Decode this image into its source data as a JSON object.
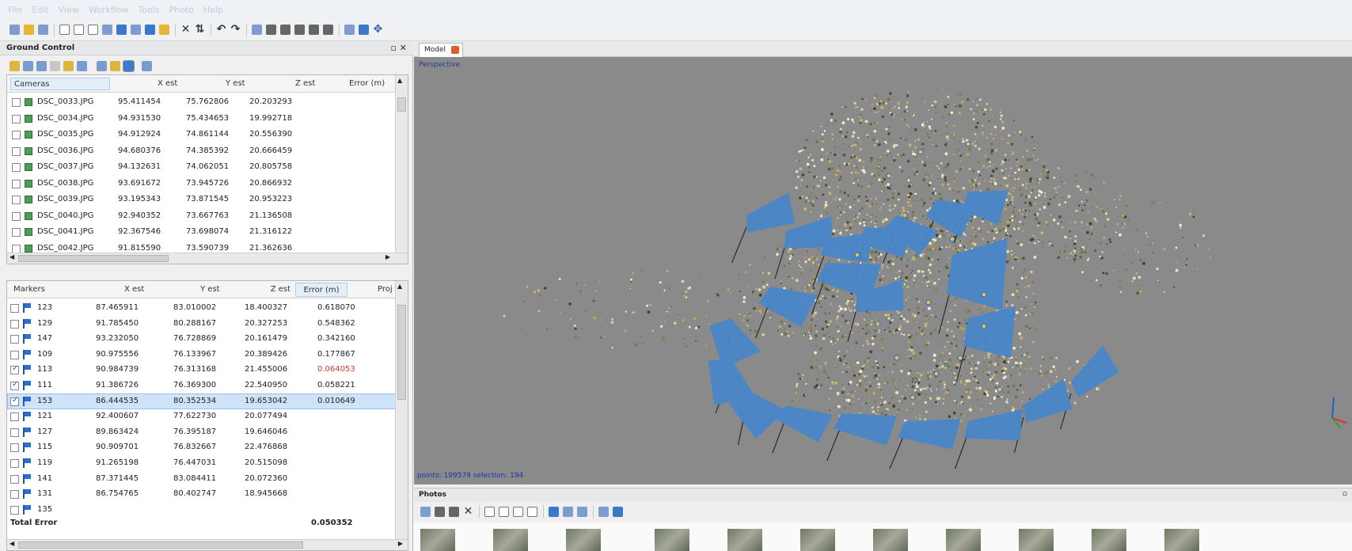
{
  "menu": [
    "File",
    "Edit",
    "View",
    "Workflow",
    "Tools",
    "Photo",
    "Help"
  ],
  "ground_control": {
    "title": "Ground Control",
    "cameras": {
      "headers": [
        "Cameras",
        "X est",
        "Y est",
        "Z est",
        "Error (m)"
      ],
      "rows": [
        {
          "name": "DSC_0033.JPG",
          "x": "95.411454",
          "y": "75.762806",
          "z": "20.203293"
        },
        {
          "name": "DSC_0034.JPG",
          "x": "94.931530",
          "y": "75.434653",
          "z": "19.992718"
        },
        {
          "name": "DSC_0035.JPG",
          "x": "94.912924",
          "y": "74.861144",
          "z": "20.556390"
        },
        {
          "name": "DSC_0036.JPG",
          "x": "94.680376",
          "y": "74.385392",
          "z": "20.666459"
        },
        {
          "name": "DSC_0037.JPG",
          "x": "94.132631",
          "y": "74.062051",
          "z": "20.805758"
        },
        {
          "name": "DSC_0038.JPG",
          "x": "93.691672",
          "y": "73.945726",
          "z": "20.866932"
        },
        {
          "name": "DSC_0039.JPG",
          "x": "93.195343",
          "y": "73.871545",
          "z": "20.953223"
        },
        {
          "name": "DSC_0040.JPG",
          "x": "92.940352",
          "y": "73.667763",
          "z": "21.136508"
        },
        {
          "name": "DSC_0041.JPG",
          "x": "92.367546",
          "y": "73.698074",
          "z": "21.316122"
        },
        {
          "name": "DSC_0042.JPG",
          "x": "91.815590",
          "y": "73.590739",
          "z": "21.362636"
        }
      ]
    },
    "markers": {
      "headers": [
        "Markers",
        "X est",
        "Y est",
        "Z est",
        "Error (m)",
        "Proj"
      ],
      "rows": [
        {
          "id": "123",
          "checked": false,
          "x": "87.465911",
          "y": "83.010002",
          "z": "18.400327",
          "err": "0.618070"
        },
        {
          "id": "129",
          "checked": false,
          "x": "91.785450",
          "y": "80.288167",
          "z": "20.327253",
          "err": "0.548362"
        },
        {
          "id": "147",
          "checked": false,
          "x": "93.232050",
          "y": "76.728869",
          "z": "20.161479",
          "err": "0.342160"
        },
        {
          "id": "109",
          "checked": false,
          "x": "90.975556",
          "y": "76.133967",
          "z": "20.389426",
          "err": "0.177867"
        },
        {
          "id": "113",
          "checked": true,
          "x": "90.984739",
          "y": "76.313168",
          "z": "21.455006",
          "err": "0.064053",
          "err_red": true
        },
        {
          "id": "111",
          "checked": true,
          "x": "91.386726",
          "y": "76.369300",
          "z": "22.540950",
          "err": "0.058221"
        },
        {
          "id": "153",
          "checked": true,
          "x": "86.444535",
          "y": "80.352534",
          "z": "19.653042",
          "err": "0.010649"
        },
        {
          "id": "121",
          "checked": false,
          "x": "92.400607",
          "y": "77.622730",
          "z": "20.077494",
          "err": ""
        },
        {
          "id": "127",
          "checked": false,
          "x": "89.863424",
          "y": "76.395187",
          "z": "19.646046",
          "err": ""
        },
        {
          "id": "115",
          "checked": false,
          "x": "90.909701",
          "y": "76.832667",
          "z": "22.476868",
          "err": ""
        },
        {
          "id": "119",
          "checked": false,
          "x": "91.265198",
          "y": "76.447031",
          "z": "20.515098",
          "err": ""
        },
        {
          "id": "141",
          "checked": false,
          "x": "87.371445",
          "y": "83.084411",
          "z": "20.072360",
          "err": ""
        },
        {
          "id": "131",
          "checked": false,
          "x": "86.754765",
          "y": "80.402747",
          "z": "18.945668",
          "err": ""
        },
        {
          "id": "135",
          "checked": false,
          "x": "",
          "y": "",
          "z": "",
          "err": ""
        }
      ],
      "total_label": "Total Error",
      "total_value": "0.050352"
    }
  },
  "model": {
    "tab_label": "Model",
    "view_label": "Perspective",
    "points_text": "points: 199579 selection: 194"
  },
  "photos": {
    "title": "Photos"
  },
  "colors": {
    "camera_plane": "#4a86c8",
    "viewport_bg": "#8a8a8a",
    "error_red": "#e03030"
  }
}
